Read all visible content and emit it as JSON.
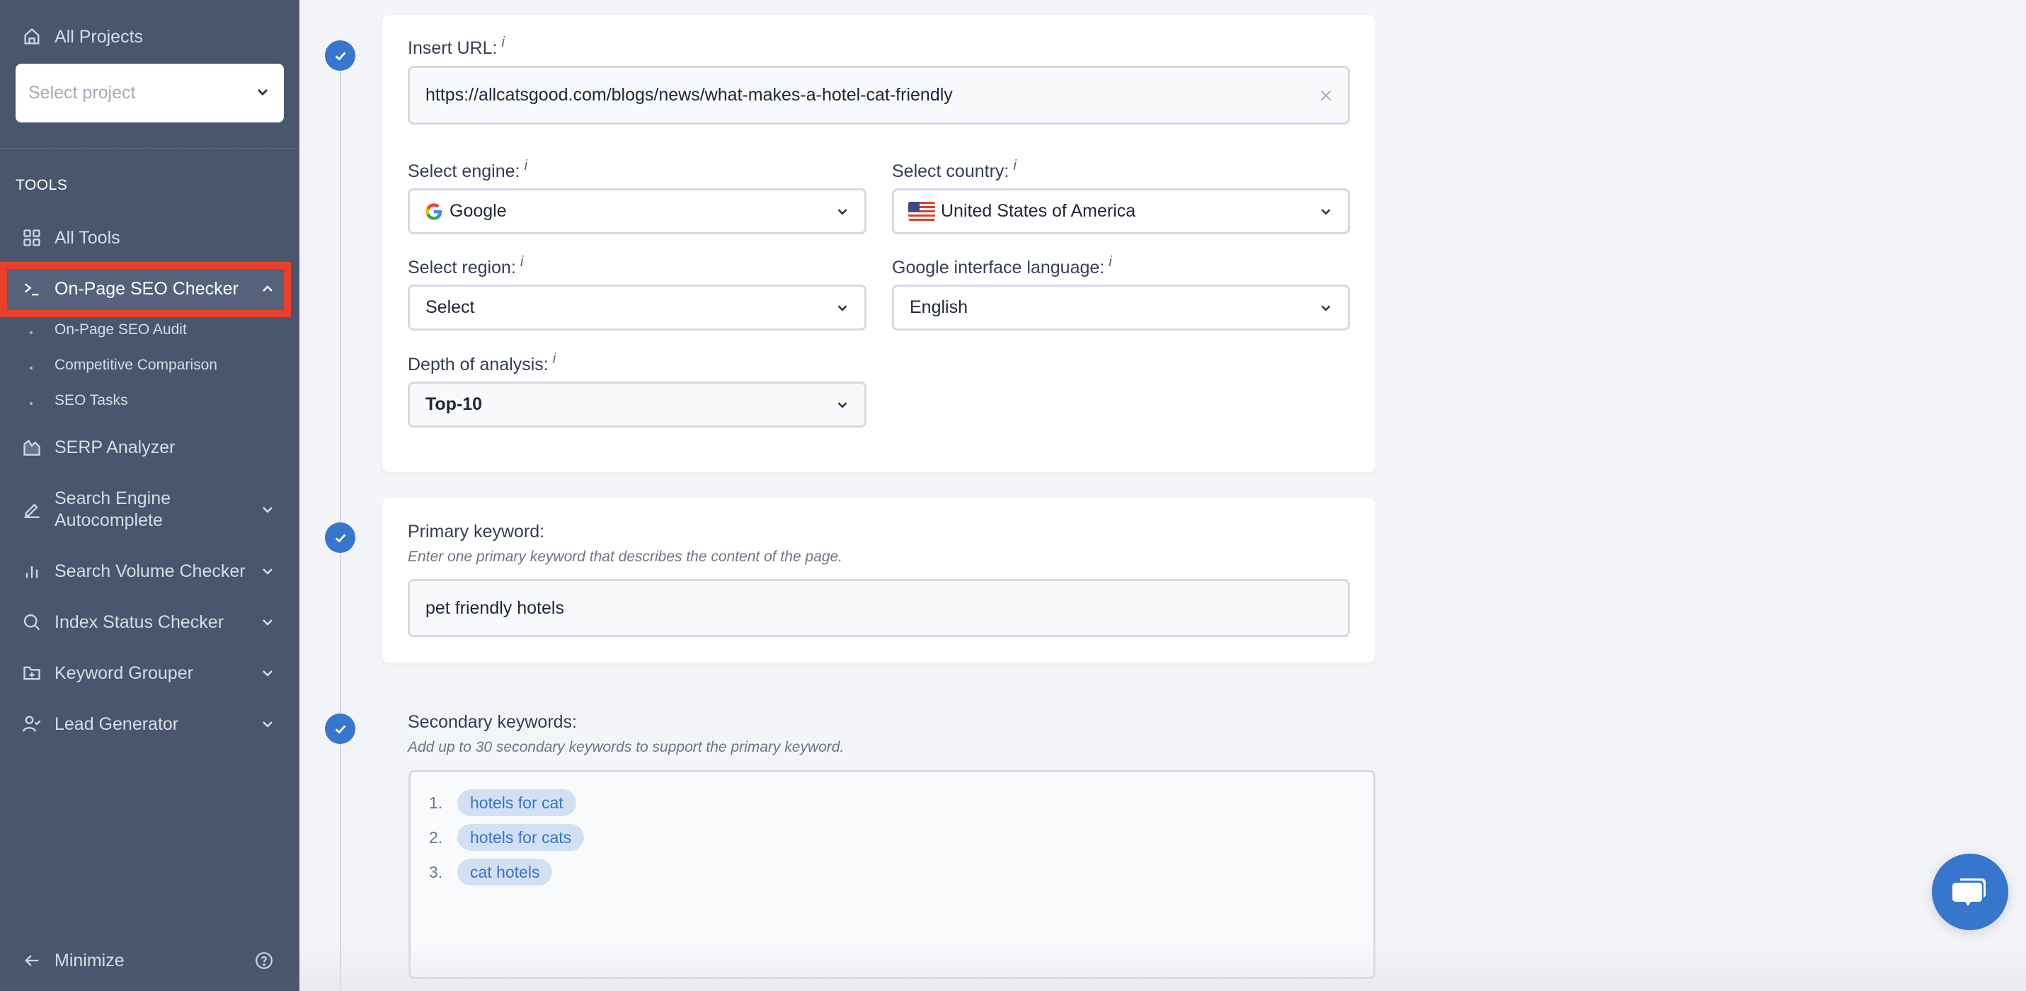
{
  "sidebar": {
    "all_projects": "All Projects",
    "project_select_placeholder": "Select project",
    "section_title": "TOOLS",
    "items": [
      {
        "label": "All Tools",
        "icon": "grid-icon"
      },
      {
        "label": "On-Page SEO Checker",
        "icon": "terminal-icon",
        "active": true,
        "expanded": true
      },
      {
        "label": "SERP Analyzer",
        "icon": "chart-area-icon"
      },
      {
        "label": "Search Engine Autocomplete",
        "icon": "pencil-icon"
      },
      {
        "label": "Search Volume Checker",
        "icon": "bar-chart-icon"
      },
      {
        "label": "Index Status Checker",
        "icon": "search-icon"
      },
      {
        "label": "Keyword Grouper",
        "icon": "folder-plus-icon"
      },
      {
        "label": "Lead Generator",
        "icon": "user-check-icon"
      }
    ],
    "subitems": [
      {
        "label": "On-Page SEO Audit"
      },
      {
        "label": "Competitive Comparison"
      },
      {
        "label": "SEO Tasks"
      }
    ],
    "search_engine_autocomplete_line1": "Search Engine",
    "search_engine_autocomplete_line2": "Autocomplete",
    "minimize_label": "Minimize"
  },
  "form": {
    "url": {
      "label": "Insert URL:",
      "info": "i",
      "value": "https://allcatsgood.com/blogs/news/what-makes-a-hotel-cat-friendly"
    },
    "engine": {
      "label": "Select engine:",
      "info": "i",
      "value": "Google"
    },
    "country": {
      "label": "Select country:",
      "info": "i",
      "value": "United States of America"
    },
    "region": {
      "label": "Select region:",
      "info": "i",
      "value": "Select"
    },
    "language": {
      "label": "Google interface language:",
      "info": "i",
      "value": "English"
    },
    "depth": {
      "label": "Depth of analysis:",
      "info": "i",
      "value": "Top-10"
    },
    "primary_keyword": {
      "label": "Primary keyword:",
      "hint": "Enter one primary keyword that describes the content of the page.",
      "value": "pet friendly hotels"
    },
    "secondary_keywords": {
      "label": "Secondary keywords:",
      "hint": "Add up to 30 secondary keywords to support the primary keyword.",
      "items": [
        {
          "num": "1.",
          "text": "hotels for cat"
        },
        {
          "num": "2.",
          "text": "hotels for cats"
        },
        {
          "num": "3.",
          "text": "cat hotels"
        }
      ]
    }
  },
  "colors": {
    "sidebar_bg": "#4a566e",
    "accent": "#3676cc",
    "highlight_box": "#e8402a",
    "pill_bg": "#d3e0f4",
    "page_bg": "#f3f4f8"
  },
  "chat": {
    "icon": "chat-bubbles-icon"
  }
}
